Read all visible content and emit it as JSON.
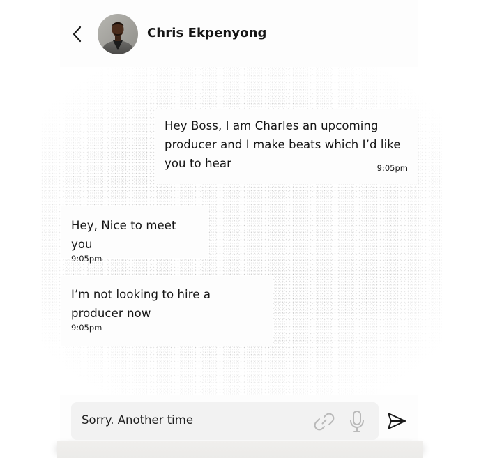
{
  "header": {
    "contact_name": "Chris Ekpenyong",
    "back_icon": "chevron-left-icon",
    "avatar_icon": "avatar"
  },
  "messages": [
    {
      "direction": "outgoing",
      "text": "Hey Boss, I am Charles an upcoming producer and I make beats which I’d like you to hear",
      "time": "9:05pm"
    },
    {
      "direction": "incoming",
      "text": "Hey, Nice to meet you",
      "time": "9:05pm"
    },
    {
      "direction": "incoming",
      "text": "I’m not looking to hire a producer now",
      "time": "9:05pm"
    }
  ],
  "composer": {
    "value": "Sorry. Another time",
    "attach_icon": "paperclip-icon",
    "mic_icon": "microphone-icon",
    "send_icon": "send-icon"
  },
  "colors": {
    "background": "#ffffff",
    "surface": "#fdfdfd",
    "input_background": "#f2f2f2",
    "text": "#151515",
    "icon_muted": "#b9b9b9"
  }
}
